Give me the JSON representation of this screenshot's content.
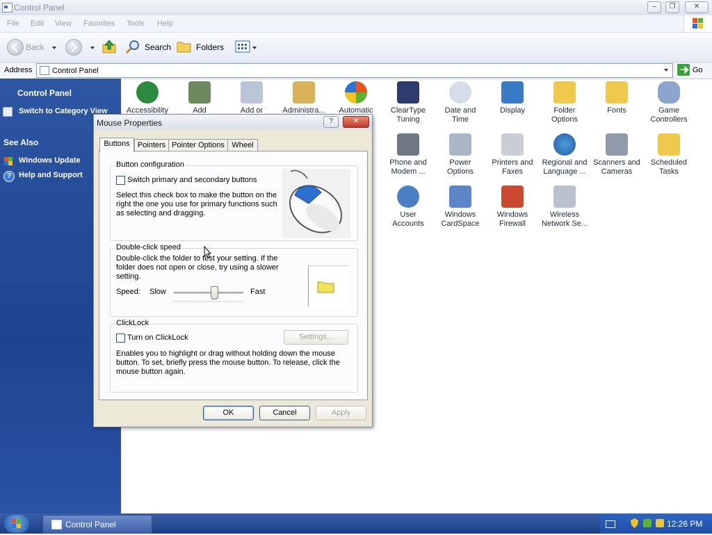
{
  "window": {
    "title": "Control Panel"
  },
  "menu": {
    "items": [
      "File",
      "Edit",
      "View",
      "Favorites",
      "Tools",
      "Help"
    ]
  },
  "toolbar": {
    "back_label": "Back",
    "search_label": "Search",
    "folders_label": "Folders"
  },
  "address": {
    "label": "Address",
    "value": "Control Panel",
    "go_label": "Go"
  },
  "taskpane": {
    "title": "Control Panel",
    "switch_view": "Switch to Category View",
    "see_also": "See Also",
    "links": [
      "Windows Update",
      "Help and Support"
    ]
  },
  "icons": [
    {
      "l1": "Accessibility",
      "l2": "",
      "icon": "accessibility-icon"
    },
    {
      "l1": "Add",
      "l2": "",
      "icon": "add-hardware-icon"
    },
    {
      "l1": "Add or",
      "l2": "",
      "icon": "add-remove-programs-icon"
    },
    {
      "l1": "Administra...",
      "l2": "",
      "icon": "administrative-tools-icon"
    },
    {
      "l1": "Automatic",
      "l2": "",
      "icon": "automatic-updates-icon"
    },
    {
      "l1": "ClearType",
      "l2": "Tuning",
      "icon": "cleartype-icon"
    },
    {
      "l1": "Date and",
      "l2": "Time",
      "icon": "date-time-icon"
    },
    {
      "l1": "Display",
      "l2": "",
      "icon": "display-icon"
    },
    {
      "l1": "Folder",
      "l2": "Options",
      "icon": "folder-options-icon"
    },
    {
      "l1": "Fonts",
      "l2": "",
      "icon": "fonts-icon"
    },
    {
      "l1": "Game",
      "l2": "Controllers",
      "icon": "game-controllers-icon"
    },
    {
      "l1": "Phone and",
      "l2": "Modem ...",
      "icon": "phone-modem-icon"
    },
    {
      "l1": "Power",
      "l2": "Options",
      "icon": "power-options-icon"
    },
    {
      "l1": "Printers and",
      "l2": "Faxes",
      "icon": "printers-icon"
    },
    {
      "l1": "Regional and",
      "l2": "Language ...",
      "icon": "regional-icon"
    },
    {
      "l1": "Scanners and",
      "l2": "Cameras",
      "icon": "scanners-icon"
    },
    {
      "l1": "Scheduled",
      "l2": "Tasks",
      "icon": "scheduled-tasks-icon"
    },
    {
      "l1": "User",
      "l2": "Accounts",
      "icon": "user-accounts-icon"
    },
    {
      "l1": "Windows",
      "l2": "CardSpace",
      "icon": "cardspace-icon"
    },
    {
      "l1": "Windows",
      "l2": "Firewall",
      "icon": "firewall-icon"
    },
    {
      "l1": "Wireless",
      "l2": "Network Se...",
      "icon": "wireless-icon"
    }
  ],
  "dialog": {
    "title": "Mouse Properties",
    "tabs": [
      "Buttons",
      "Pointers",
      "Pointer Options",
      "Wheel"
    ],
    "button_config": {
      "title": "Button configuration",
      "checkbox_label": "Switch primary and secondary buttons",
      "checked": false,
      "desc": [
        "Select this check box to make the button on the",
        "right the one you use for primary functions such",
        "as selecting and dragging."
      ]
    },
    "double_click": {
      "title": "Double-click speed",
      "desc": [
        "Double-click the folder to test your setting. If the",
        "folder does not open or close, try using a slower",
        "setting."
      ],
      "speed_label": "Speed:",
      "slow": "Slow",
      "fast": "Fast",
      "speed_level": 0.58
    },
    "clicklock": {
      "title": "ClickLock",
      "checkbox_label": "Turn on ClickLock",
      "checked": false,
      "settings_button": "Settings...",
      "desc": [
        "Enables you to highlight or drag without holding down the mouse",
        "button. To set, briefly press the mouse button. To release, click the",
        "mouse button again."
      ]
    },
    "buttons": {
      "ok": "OK",
      "cancel": "Cancel",
      "apply": "Apply"
    }
  },
  "taskbar": {
    "task_label": "Control Panel",
    "clock": "12:26 PM"
  },
  "colors": {
    "taskpane": "#2450a0",
    "taskbar": "#27498f",
    "dialog_face": "#ece9d8"
  }
}
